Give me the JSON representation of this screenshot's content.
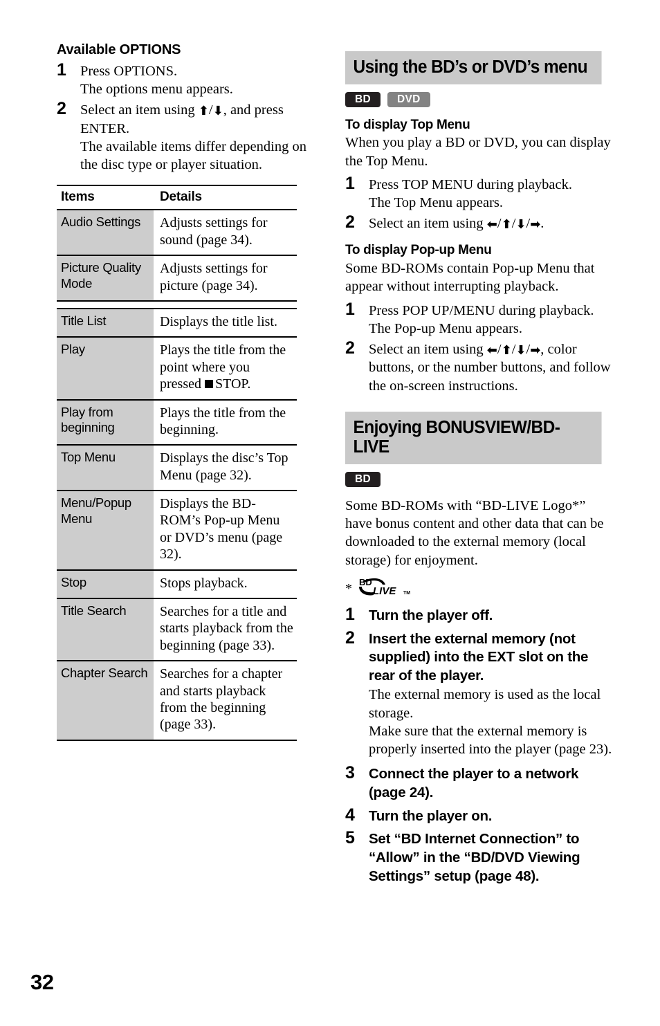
{
  "page_number": "32",
  "left_column": {
    "heading": "Available OPTIONS",
    "steps": [
      {
        "num": "1",
        "lines": [
          "Press OPTIONS.",
          "The options menu appears."
        ]
      },
      {
        "num": "2",
        "lines": [
          "Select an item using ↑/↓, and press ENTER.",
          "The available items differ depending on the disc type or player situation."
        ]
      }
    ],
    "table": {
      "headers": [
        "Items",
        "Details"
      ],
      "groups": [
        {
          "rows": [
            {
              "item": "Audio Settings",
              "detail": "Adjusts settings for sound (page 34)."
            },
            {
              "item": "Picture Quality Mode",
              "detail": "Adjusts settings for picture (page 34)."
            }
          ]
        },
        {
          "rows": [
            {
              "item": "Title List",
              "detail": "Displays the title list."
            },
            {
              "item": "Play",
              "detail": "Plays the title from the point where you pressed ■ STOP."
            },
            {
              "item": "Play from beginning",
              "detail": "Plays the title from the beginning."
            },
            {
              "item": "Top Menu",
              "detail": "Displays the disc’s Top Menu (page 32)."
            },
            {
              "item": "Menu/Popup Menu",
              "detail": "Displays the BD-ROM’s Pop-up Menu or DVD’s menu (page 32)."
            },
            {
              "item": "Stop",
              "detail": "Stops playback."
            },
            {
              "item": "Title Search",
              "detail": "Searches for a title and starts playback from the beginning (page 33)."
            },
            {
              "item": "Chapter Search",
              "detail": "Searches for a chapter and starts playback from the beginning (page 33)."
            }
          ]
        }
      ]
    }
  },
  "right_column": {
    "section_menu": {
      "title": "Using the BD’s or DVD’s menu",
      "badges": [
        "BD",
        "DVD"
      ],
      "top_menu": {
        "heading": "To display Top Menu",
        "intro": "When you play a BD or DVD, you can display the Top Menu.",
        "steps": [
          {
            "num": "1",
            "lines": [
              "Press TOP MENU during playback.",
              "The Top Menu appears."
            ]
          },
          {
            "num": "2",
            "lines": [
              "Select an item using ←/↑/↓/→."
            ]
          }
        ]
      },
      "popup_menu": {
        "heading": "To display Pop-up Menu",
        "intro": "Some BD-ROMs contain Pop-up Menu that appear without interrupting playback.",
        "steps": [
          {
            "num": "1",
            "lines": [
              "Press POP UP/MENU during playback.",
              "The Pop-up Menu appears."
            ]
          },
          {
            "num": "2",
            "lines": [
              "Select an item using ←/↑/↓/→, color buttons, or the number buttons, and follow the on-screen instructions."
            ]
          }
        ]
      }
    },
    "section_bonusview": {
      "title": "Enjoying BONUSVIEW/BD-LIVE",
      "badges": [
        "BD"
      ],
      "intro": "Some BD-ROMs with “BD-LIVE Logo*” have bonus content and other data that can be downloaded to the external memory (local storage) for enjoyment.",
      "logo_note": {
        "asterisk": "*",
        "logo_bd": "BD",
        "logo_live": "LIVE",
        "logo_tm": "TM"
      },
      "steps": [
        {
          "num": "1",
          "lead": "Turn the player off.",
          "note": ""
        },
        {
          "num": "2",
          "lead": "Insert the external memory (not supplied) into the EXT slot on the rear of the player.",
          "note": "The external memory is used as the local storage.\nMake sure that the external memory is properly inserted into the player (page 23)."
        },
        {
          "num": "3",
          "lead": "Connect the player to a network (page 24).",
          "note": ""
        },
        {
          "num": "4",
          "lead": "Turn the player on.",
          "note": ""
        },
        {
          "num": "5",
          "lead": "Set “BD Internet Connection” to “Allow” in the “BD/DVD Viewing Settings” setup (page 48).",
          "note": ""
        }
      ]
    }
  }
}
